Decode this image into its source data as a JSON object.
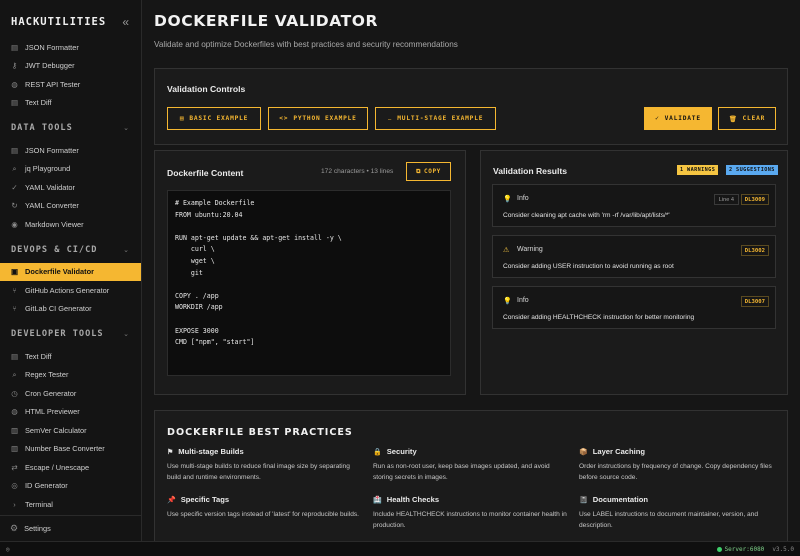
{
  "brand": {
    "title": "HACKUTILITIES",
    "collapse_icon": "double-chevron-left-icon"
  },
  "sidebar": {
    "top_items": [
      {
        "label": "JSON Formatter",
        "icon": "file-icon"
      },
      {
        "label": "JWT Debugger",
        "icon": "key-icon"
      },
      {
        "label": "REST API Tester",
        "icon": "globe-icon"
      },
      {
        "label": "Text Diff",
        "icon": "file-icon"
      }
    ],
    "sections": [
      {
        "title": "DATA TOOLS",
        "items": [
          {
            "label": "JSON Formatter",
            "icon": "file-icon"
          },
          {
            "label": "jq Playground",
            "icon": "search-icon"
          },
          {
            "label": "YAML Validator",
            "icon": "check-icon"
          },
          {
            "label": "YAML Converter",
            "icon": "refresh-icon"
          },
          {
            "label": "Markdown Viewer",
            "icon": "eye-icon"
          }
        ]
      },
      {
        "title": "DEVOPS & CI/CD",
        "items": [
          {
            "label": "Dockerfile Validator",
            "icon": "container-icon",
            "active": true
          },
          {
            "label": "GitHub Actions Generator",
            "icon": "branch-icon"
          },
          {
            "label": "GitLab CI Generator",
            "icon": "branch-icon"
          }
        ]
      },
      {
        "title": "DEVELOPER TOOLS",
        "items": [
          {
            "label": "Text Diff",
            "icon": "file-icon"
          },
          {
            "label": "Regex Tester",
            "icon": "search-icon"
          },
          {
            "label": "Cron Generator",
            "icon": "clock-icon"
          },
          {
            "label": "HTML Previewer",
            "icon": "globe-icon"
          },
          {
            "label": "SemVer Calculator",
            "icon": "bar-chart-icon"
          },
          {
            "label": "Number Base Converter",
            "icon": "bar-chart-icon"
          },
          {
            "label": "Escape / Unescape",
            "icon": "shuffle-icon"
          },
          {
            "label": "ID Generator",
            "icon": "fingerprint-icon"
          },
          {
            "label": "Terminal",
            "icon": "terminal-icon"
          }
        ]
      }
    ],
    "settings_label": "Settings"
  },
  "statusbar": {
    "server": "Server:6080",
    "version": "v3.5.0"
  },
  "page": {
    "title": "DOCKERFILE VALIDATOR",
    "subtitle": "Validate and optimize Dockerfiles with best practices and security recommendations"
  },
  "controls": {
    "title": "Validation Controls",
    "basic": "BASIC EXAMPLE",
    "python": "PYTHON EXAMPLE",
    "multistage": "MULTI-STAGE EXAMPLE",
    "validate": "VALIDATE",
    "clear": "CLEAR"
  },
  "editor": {
    "title": "Dockerfile Content",
    "meta": "172 characters  •  13 lines",
    "copy": "COPY",
    "content": "# Example Dockerfile\nFROM ubuntu:20.04\n\nRUN apt-get update && apt-get install -y \\\n    curl \\\n    wget \\\n    git\n\nCOPY . /app\nWORKDIR /app\n\nEXPOSE 3000\nCMD [\"npm\", \"start\"]"
  },
  "results": {
    "title": "Validation Results",
    "warnings_badge": "1 WARNINGS",
    "suggestions_badge": "2 SUGGESTIONS",
    "colors": {
      "warning": "#f5c542",
      "suggestion": "#5aa9f0"
    },
    "items": [
      {
        "type": "Info",
        "icon": "lightbulb-icon",
        "line": "Line 4",
        "code": "DL3009",
        "message": "Consider cleaning apt cache with 'rm -rf /var/lib/apt/lists/*'"
      },
      {
        "type": "Warning",
        "icon": "warning-icon",
        "line": "",
        "code": "DL3002",
        "message": "Consider adding USER instruction to avoid running as root"
      },
      {
        "type": "Info",
        "icon": "lightbulb-icon",
        "line": "",
        "code": "DL3007",
        "message": "Consider adding HEALTHCHECK instruction for better monitoring"
      }
    ]
  },
  "best_practices": {
    "title": "DOCKERFILE BEST PRACTICES",
    "items": [
      {
        "title": "Multi-stage Builds",
        "icon": "flag-icon",
        "desc": "Use multi-stage builds to reduce final image size by separating build and runtime environments."
      },
      {
        "title": "Security",
        "icon": "lock-icon",
        "desc": "Run as non-root user, keep base images updated, and avoid storing secrets in images."
      },
      {
        "title": "Layer Caching",
        "icon": "box-icon",
        "desc": "Order instructions by frequency of change. Copy dependency files before source code."
      },
      {
        "title": "Specific Tags",
        "icon": "pin-icon",
        "desc": "Use specific version tags instead of 'latest' for reproducible builds."
      },
      {
        "title": "Health Checks",
        "icon": "hospital-icon",
        "desc": "Include HEALTHCHECK instructions to monitor container health in production."
      },
      {
        "title": "Documentation",
        "icon": "notebook-icon",
        "desc": "Use LABEL instructions to document maintainer, version, and description."
      }
    ]
  }
}
